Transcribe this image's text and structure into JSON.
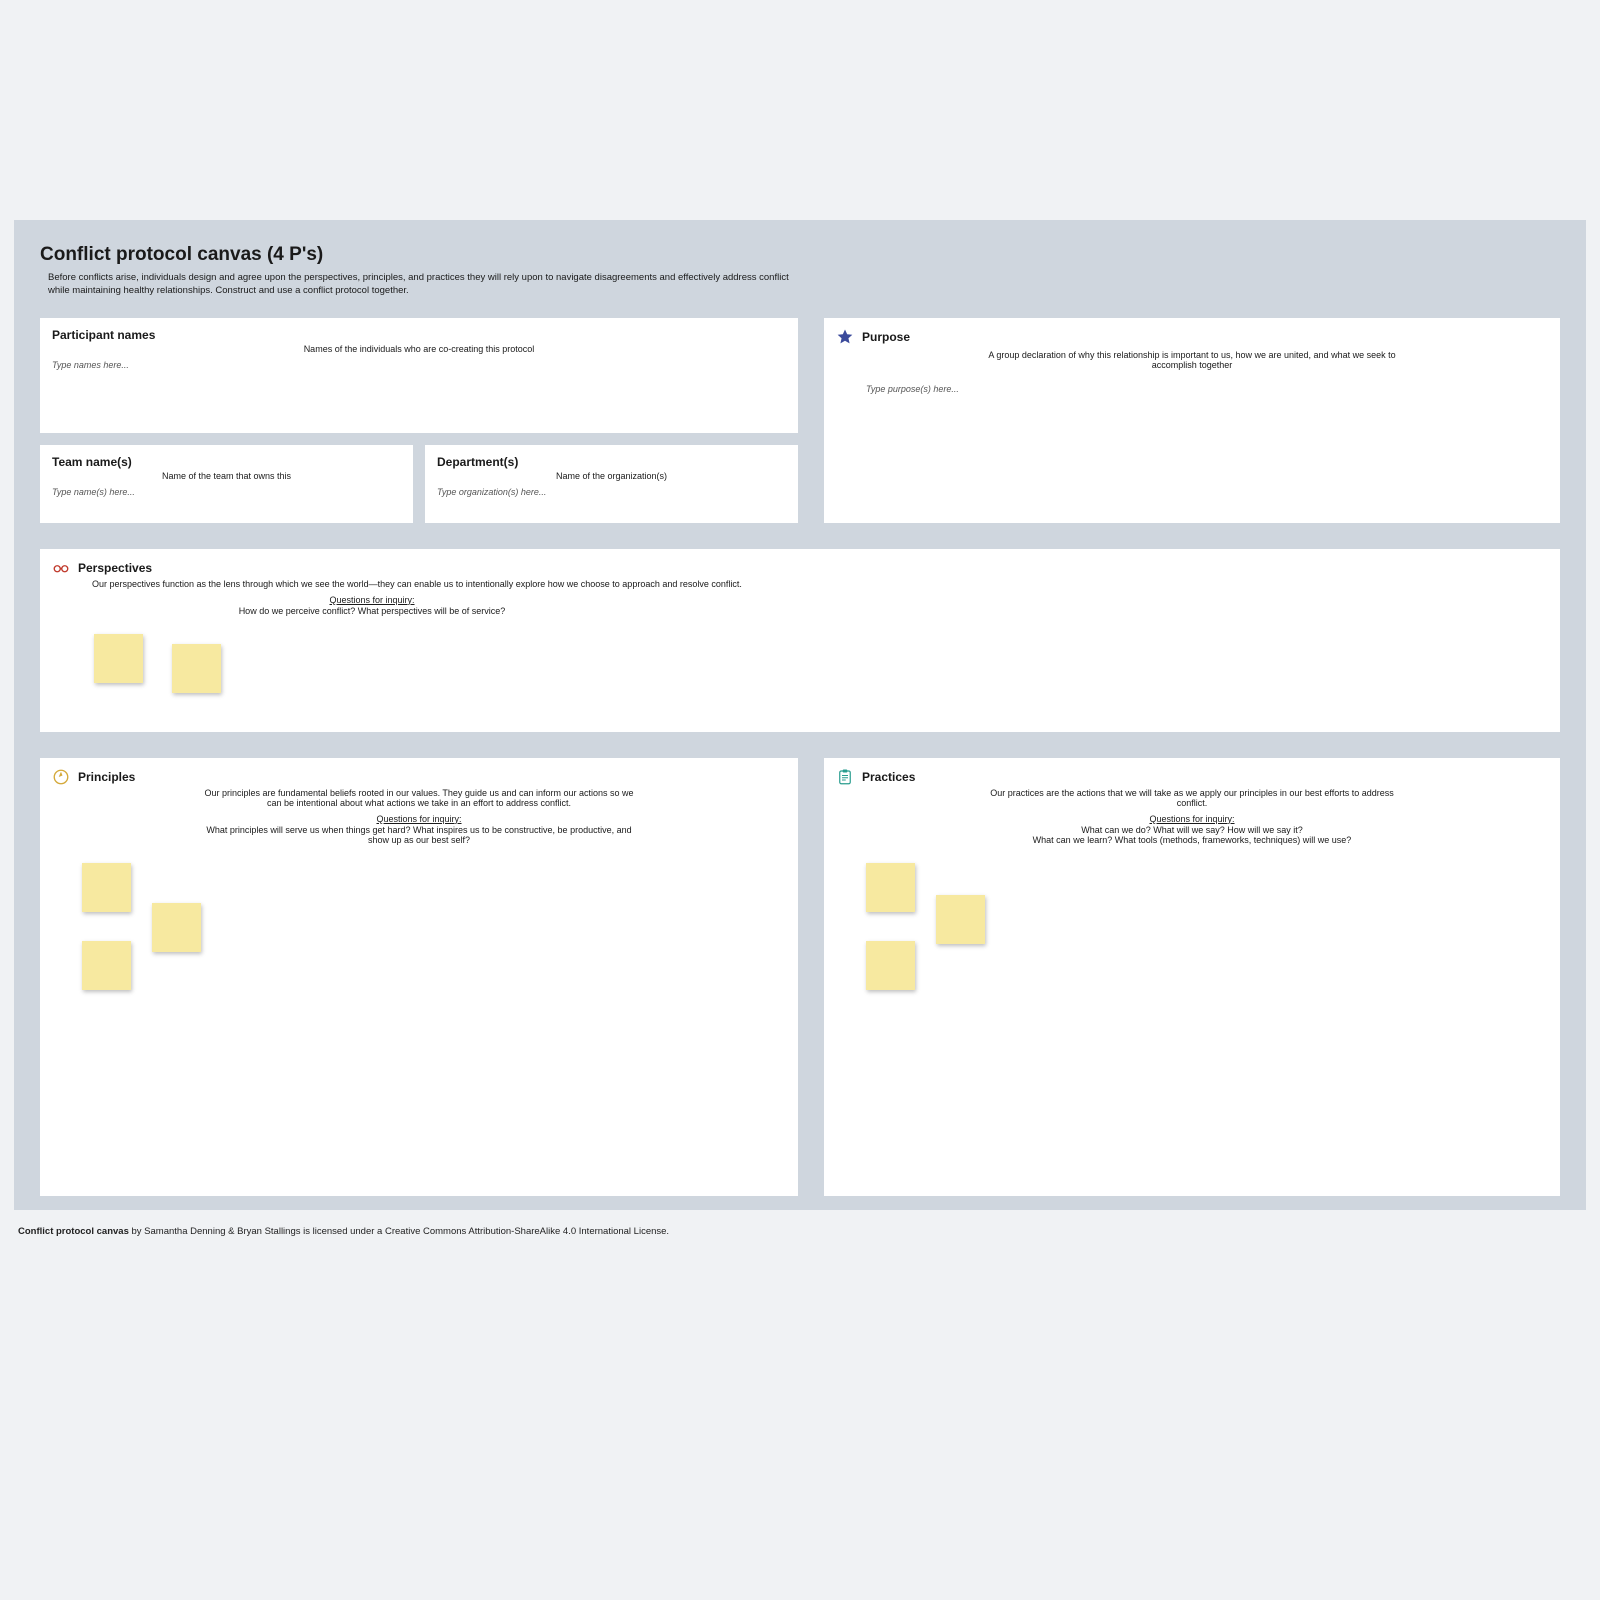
{
  "header": {
    "title": "Conflict protocol canvas (4 P's)",
    "subtitle": "Before conflicts arise, individuals design and agree upon the perspectives, principles, and practices they will rely upon to navigate disagreements and effectively address conflict while maintaining healthy relationships. Construct and use a conflict protocol together."
  },
  "participants": {
    "title": "Participant names",
    "desc": "Names of the individuals who are co-creating this protocol",
    "placeholder": "Type names here..."
  },
  "team": {
    "title": "Team name(s)",
    "desc": "Name of the team that owns this",
    "placeholder": "Type name(s) here..."
  },
  "department": {
    "title": "Department(s)",
    "desc": "Name of the organization(s)",
    "placeholder": "Type organization(s) here..."
  },
  "purpose": {
    "title": "Purpose",
    "desc": "A group declaration of why this relationship is important to us, how we are united, and what we seek to accomplish together",
    "placeholder": "Type purpose(s) here..."
  },
  "perspectives": {
    "title": "Perspectives",
    "desc": "Our perspectives function as the lens through which we see the world—they can enable us to intentionally explore how we choose to approach and resolve conflict.",
    "inquiry_label": "Questions for inquiry:",
    "inquiry_text": "How do we perceive conflict? What perspectives will be of service?"
  },
  "principles": {
    "title": "Principles",
    "desc": "Our principles are fundamental beliefs rooted in our values. They guide us and can inform our actions so we can be intentional about what actions we take in an effort to address conflict.",
    "inquiry_label": "Questions for inquiry:",
    "inquiry_text": "What principles will serve us when things get hard? What inspires us to be constructive, be productive, and show up as our best self?"
  },
  "practices": {
    "title": "Practices",
    "desc": "Our practices are the actions that we will take as we apply our principles in our best efforts to address conflict.",
    "inquiry_label": "Questions for inquiry:",
    "inquiry_text": "What can we do? What will we say? How will we say it?\nWhat can we learn? What tools (methods, frameworks, techniques) will we use?"
  },
  "footer": {
    "bold": "Conflict protocol canvas",
    "rest": " by Samantha Denning & Bryan Stallings is licensed under a Creative Commons Attribution-ShareAlike 4.0 International License."
  }
}
